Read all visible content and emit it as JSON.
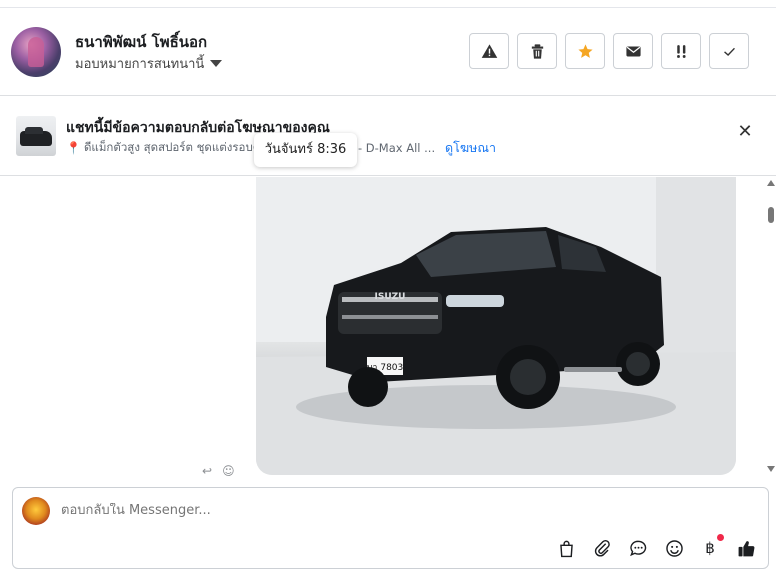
{
  "header": {
    "name": "ธนาพิพัฒน์ โพธิ์นอก",
    "assign_label": "มอบหมายการสนทนานี้",
    "actions": [
      "spam-icon",
      "trash-icon",
      "star-icon",
      "mail-icon",
      "important-icon",
      "check-icon"
    ]
  },
  "ad_bar": {
    "title": "แชทนี้มีข้อความตอบกลับต่อโฆษณาของคุณ",
    "subtitle_prefix": "ดีแม็กตัวสูง สุดสปอร์ต ชุดแต่งรอบคั",
    "subtitle_suffix": "/ - D-Max All ...",
    "view_ad": "ดูโฆษณา"
  },
  "tooltip": {
    "timestamp": "วันจันทร์ 8:36"
  },
  "photo": {
    "plate_text": "บา 7803",
    "brand_text": "ISUZU"
  },
  "composer": {
    "placeholder": "ตอบกลับใน Messenger...",
    "tools": [
      "bag-icon",
      "attach-icon",
      "chat-bubble-icon",
      "emoji-icon",
      "baht-icon",
      "like-icon"
    ]
  },
  "colors": {
    "link": "#1877f2",
    "star": "#f5a623",
    "notification_dot": "#f02849"
  }
}
